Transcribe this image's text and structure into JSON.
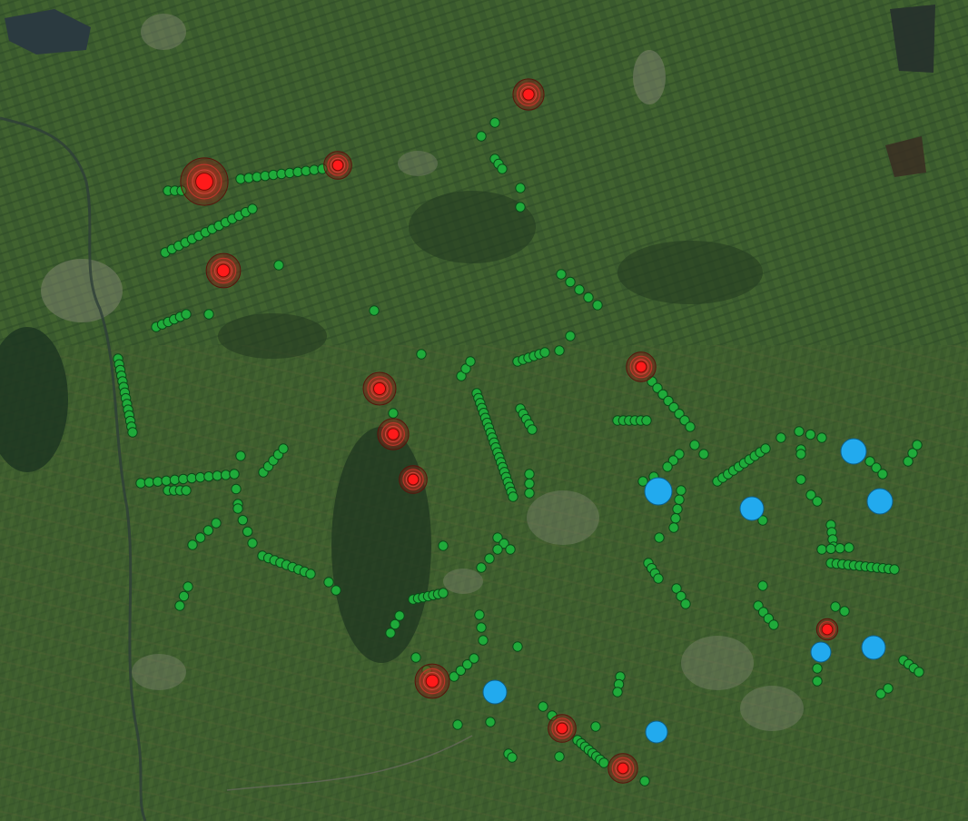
{
  "map": {
    "base_layer": "satellite",
    "colors": {
      "monitoring_point": "#1faa3a",
      "monitoring_point_stroke": "#0b4a18",
      "alert_site": "#ff1a1a",
      "alert_halo": "#8b1a12",
      "station": "#22aaee",
      "station_stroke": "#0d5f8a",
      "land_dark": "#2a4424",
      "land_mid": "#3d5e30",
      "land_light": "#5a6a38",
      "water": "#2b3a40",
      "urban": "#8a8a7a",
      "forest": "#1f3520"
    },
    "layers": [
      {
        "name": "monitoring-points",
        "icon": "green-circle-icon"
      },
      {
        "name": "alert-sites",
        "icon": "red-ringed-circle-icon"
      },
      {
        "name": "stations",
        "icon": "blue-circle-icon"
      }
    ]
  }
}
